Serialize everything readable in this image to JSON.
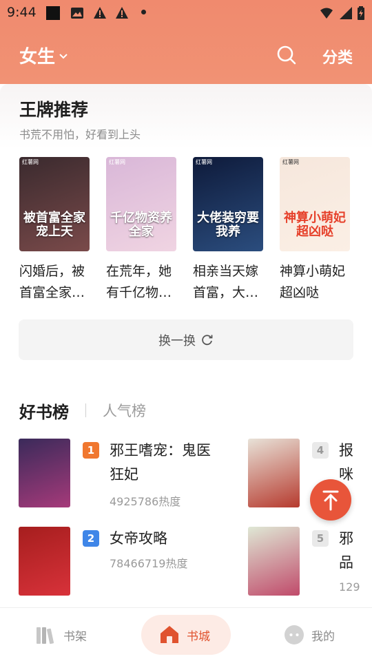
{
  "status": {
    "time": "9:44"
  },
  "header": {
    "gender": "女生",
    "category": "分类"
  },
  "recommend": {
    "title": "王牌推荐",
    "subtitle": "书荒不用怕，好看到上头",
    "books": [
      {
        "title": "闪婚后，被首富全家宠上天",
        "cover_text": "被首富全家宠上天",
        "cover_tag": "红薯网",
        "colors": [
          "#3a2a2e",
          "#7a4a4a"
        ]
      },
      {
        "title": "在荒年，她有千亿物资养全家",
        "cover_text": "千亿物资养全家",
        "cover_tag": "红薯网",
        "colors": [
          "#d9b7d8",
          "#f0d4e2"
        ]
      },
      {
        "title": "相亲当天嫁首富，大佬装穷要我养",
        "cover_text": "大佬装穷要我养",
        "cover_tag": "红薯网",
        "colors": [
          "#0e1a3a",
          "#2b4d7e"
        ]
      },
      {
        "title": "神算小萌妃超凶哒",
        "cover_text": "神算小萌妃超凶哒",
        "cover_tag": "红薯网",
        "colors": [
          "#f6e7dc",
          "#fbefe5"
        ]
      }
    ],
    "refresh_label": "换一换"
  },
  "ranking": {
    "active_tab": "好书榜",
    "inactive_tab": "人气榜",
    "items": [
      {
        "rank": "1",
        "title": "邪王嗜宠：鬼医狂妃",
        "heat": "4925786热度",
        "rank_color": "#f0772f",
        "colors": [
          "#3a2a5a",
          "#a63a7a"
        ]
      },
      {
        "rank": "4",
        "title": "报咪",
        "heat": "",
        "rank_color": "#e9e9e9",
        "colors": [
          "#e8e2d8",
          "#b63a2e"
        ]
      },
      {
        "rank": "2",
        "title": "女帝攻略",
        "heat": "78466719热度",
        "rank_color": "#3f86e8",
        "colors": [
          "#a61e1e",
          "#d8323a"
        ]
      },
      {
        "rank": "5",
        "title": "邪品",
        "heat": "129",
        "rank_color": "#e9e9e9",
        "colors": [
          "#dfe8d5",
          "#c04a6a"
        ]
      }
    ]
  },
  "bottom_nav": [
    {
      "label": "书架"
    },
    {
      "label": "书城"
    },
    {
      "label": "我的"
    }
  ]
}
